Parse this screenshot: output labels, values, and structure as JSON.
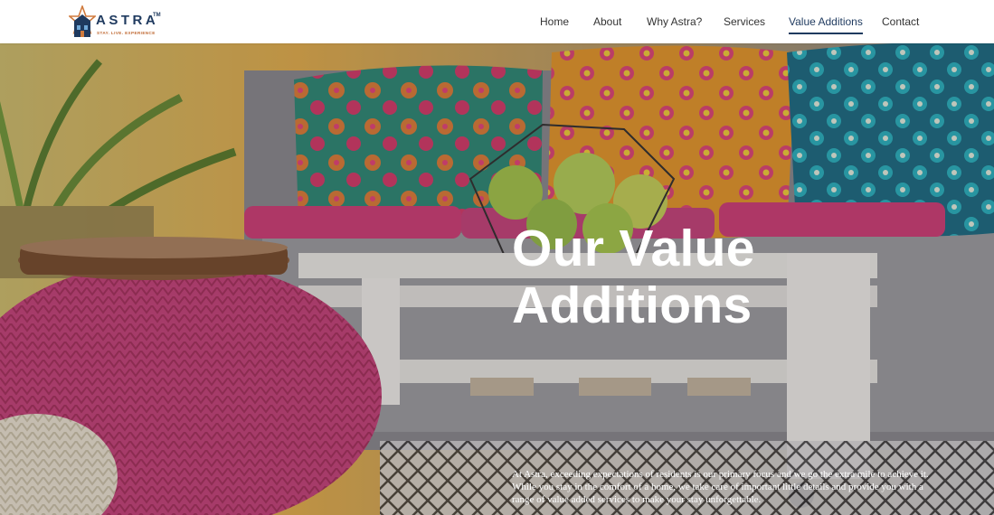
{
  "brand": {
    "name": "ASTRA",
    "trademark": "TM",
    "tagline": "STAY. LIVE. EXPERIENCE"
  },
  "nav": {
    "items": [
      {
        "label": "Home",
        "active": false
      },
      {
        "label": "About",
        "active": false
      },
      {
        "label": "Why Astra?",
        "active": false
      },
      {
        "label": "Services",
        "active": false
      },
      {
        "label": "Value Additions",
        "active": true
      },
      {
        "label": "Contact",
        "active": false
      }
    ]
  },
  "hero": {
    "title": "Our Value Additions",
    "description": "At Astra, exceeding expectations of residents is our primary focus and we go the extra mile to achieve it. While you stay in the comfort of a home, we take care of important little details and provide you with a range of value added services to make your stay unforgettable."
  },
  "colors": {
    "brand_navy": "#1f3a5f",
    "brand_orange": "#c06a34",
    "pouf_pink": "#c9457d"
  }
}
